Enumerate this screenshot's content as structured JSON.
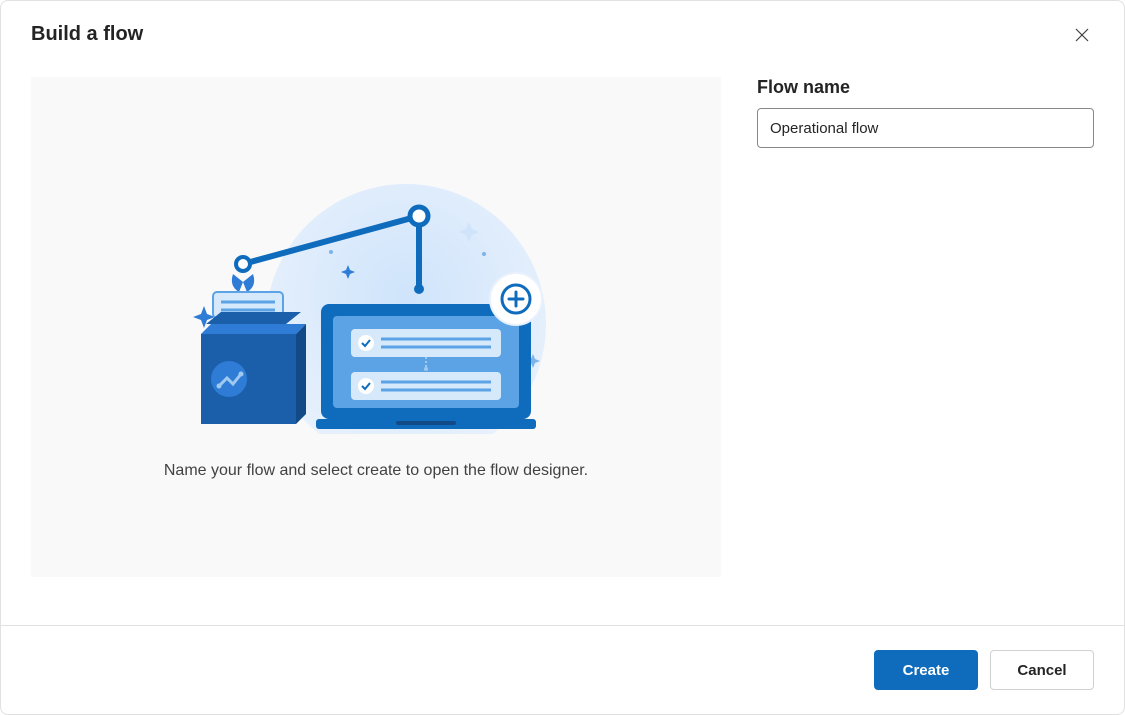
{
  "dialog": {
    "title": "Build a flow",
    "caption": "Name your flow and select create to open the flow designer."
  },
  "form": {
    "flowNameLabel": "Flow name",
    "flowNameValue": "Operational flow"
  },
  "actions": {
    "primary": "Create",
    "secondary": "Cancel"
  }
}
